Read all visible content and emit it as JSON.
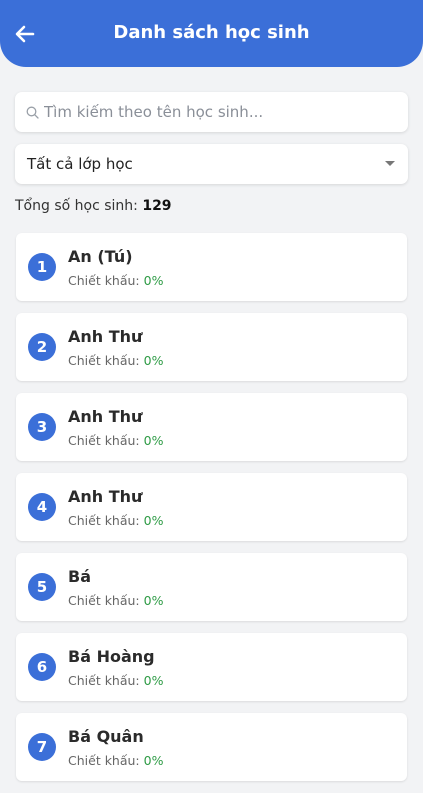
{
  "header": {
    "title": "Danh sách học sinh",
    "back_icon": "arrow-left-icon",
    "bg_color": "#3b6fd8"
  },
  "search": {
    "placeholder": "Tìm kiếm theo tên học sinh...",
    "value": "",
    "icon": "search-icon"
  },
  "class_filter": {
    "selected": "Tất cả lớp học",
    "icon": "caret-down-icon"
  },
  "summary": {
    "label": "Tổng số học sinh:",
    "count": "129"
  },
  "students": [
    {
      "index": "1",
      "name": "An (Tú)",
      "discount_label": "Chiết khấu:",
      "discount_value": "0%"
    },
    {
      "index": "2",
      "name": "Anh Thư",
      "discount_label": "Chiết khấu:",
      "discount_value": "0%"
    },
    {
      "index": "3",
      "name": "Anh Thư",
      "discount_label": "Chiết khấu:",
      "discount_value": "0%"
    },
    {
      "index": "4",
      "name": "Anh Thư",
      "discount_label": "Chiết khấu:",
      "discount_value": "0%"
    },
    {
      "index": "5",
      "name": "Bá",
      "discount_label": "Chiết khấu:",
      "discount_value": "0%"
    },
    {
      "index": "6",
      "name": "Bá Hoàng",
      "discount_label": "Chiết khấu:",
      "discount_value": "0%"
    },
    {
      "index": "7",
      "name": "Bá Quân",
      "discount_label": "Chiết khấu:",
      "discount_value": "0%"
    }
  ],
  "colors": {
    "accent": "#3b6fd8",
    "discount_green": "#2e9b45",
    "background": "#f2f3f5"
  }
}
